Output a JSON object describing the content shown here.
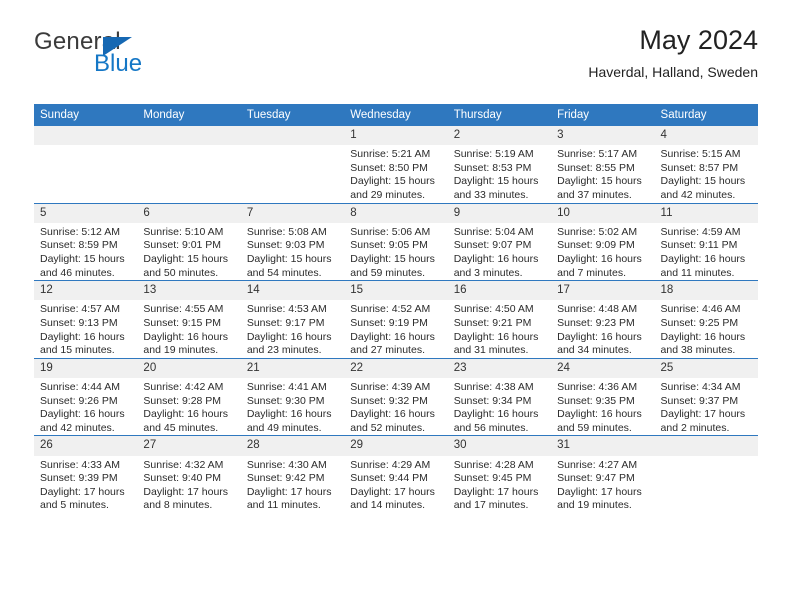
{
  "brand": {
    "name_top": "General",
    "name_bottom": "Blue",
    "triangle_color": "#1668b3",
    "blue_color": "#1577c6"
  },
  "header": {
    "title": "May 2024",
    "subtitle": "Haverdal, Halland, Sweden"
  },
  "theme": {
    "header_bg": "#2f78bf",
    "header_text": "#ffffff",
    "daynum_bg": "#f0f0f0",
    "grid_line": "#2f78bf",
    "page_bg": "#ffffff"
  },
  "calendar": {
    "weekday_headers": [
      "Sunday",
      "Monday",
      "Tuesday",
      "Wednesday",
      "Thursday",
      "Friday",
      "Saturday"
    ],
    "weeks": [
      [
        {
          "day": "",
          "empty": true
        },
        {
          "day": "",
          "empty": true
        },
        {
          "day": "",
          "empty": true
        },
        {
          "day": "1",
          "sunrise": "Sunrise: 5:21 AM",
          "sunset": "Sunset: 8:50 PM",
          "daylight": "Daylight: 15 hours and 29 minutes."
        },
        {
          "day": "2",
          "sunrise": "Sunrise: 5:19 AM",
          "sunset": "Sunset: 8:53 PM",
          "daylight": "Daylight: 15 hours and 33 minutes."
        },
        {
          "day": "3",
          "sunrise": "Sunrise: 5:17 AM",
          "sunset": "Sunset: 8:55 PM",
          "daylight": "Daylight: 15 hours and 37 minutes."
        },
        {
          "day": "4",
          "sunrise": "Sunrise: 5:15 AM",
          "sunset": "Sunset: 8:57 PM",
          "daylight": "Daylight: 15 hours and 42 minutes."
        }
      ],
      [
        {
          "day": "5",
          "sunrise": "Sunrise: 5:12 AM",
          "sunset": "Sunset: 8:59 PM",
          "daylight": "Daylight: 15 hours and 46 minutes."
        },
        {
          "day": "6",
          "sunrise": "Sunrise: 5:10 AM",
          "sunset": "Sunset: 9:01 PM",
          "daylight": "Daylight: 15 hours and 50 minutes."
        },
        {
          "day": "7",
          "sunrise": "Sunrise: 5:08 AM",
          "sunset": "Sunset: 9:03 PM",
          "daylight": "Daylight: 15 hours and 54 minutes."
        },
        {
          "day": "8",
          "sunrise": "Sunrise: 5:06 AM",
          "sunset": "Sunset: 9:05 PM",
          "daylight": "Daylight: 15 hours and 59 minutes."
        },
        {
          "day": "9",
          "sunrise": "Sunrise: 5:04 AM",
          "sunset": "Sunset: 9:07 PM",
          "daylight": "Daylight: 16 hours and 3 minutes."
        },
        {
          "day": "10",
          "sunrise": "Sunrise: 5:02 AM",
          "sunset": "Sunset: 9:09 PM",
          "daylight": "Daylight: 16 hours and 7 minutes."
        },
        {
          "day": "11",
          "sunrise": "Sunrise: 4:59 AM",
          "sunset": "Sunset: 9:11 PM",
          "daylight": "Daylight: 16 hours and 11 minutes."
        }
      ],
      [
        {
          "day": "12",
          "sunrise": "Sunrise: 4:57 AM",
          "sunset": "Sunset: 9:13 PM",
          "daylight": "Daylight: 16 hours and 15 minutes."
        },
        {
          "day": "13",
          "sunrise": "Sunrise: 4:55 AM",
          "sunset": "Sunset: 9:15 PM",
          "daylight": "Daylight: 16 hours and 19 minutes."
        },
        {
          "day": "14",
          "sunrise": "Sunrise: 4:53 AM",
          "sunset": "Sunset: 9:17 PM",
          "daylight": "Daylight: 16 hours and 23 minutes."
        },
        {
          "day": "15",
          "sunrise": "Sunrise: 4:52 AM",
          "sunset": "Sunset: 9:19 PM",
          "daylight": "Daylight: 16 hours and 27 minutes."
        },
        {
          "day": "16",
          "sunrise": "Sunrise: 4:50 AM",
          "sunset": "Sunset: 9:21 PM",
          "daylight": "Daylight: 16 hours and 31 minutes."
        },
        {
          "day": "17",
          "sunrise": "Sunrise: 4:48 AM",
          "sunset": "Sunset: 9:23 PM",
          "daylight": "Daylight: 16 hours and 34 minutes."
        },
        {
          "day": "18",
          "sunrise": "Sunrise: 4:46 AM",
          "sunset": "Sunset: 9:25 PM",
          "daylight": "Daylight: 16 hours and 38 minutes."
        }
      ],
      [
        {
          "day": "19",
          "sunrise": "Sunrise: 4:44 AM",
          "sunset": "Sunset: 9:26 PM",
          "daylight": "Daylight: 16 hours and 42 minutes."
        },
        {
          "day": "20",
          "sunrise": "Sunrise: 4:42 AM",
          "sunset": "Sunset: 9:28 PM",
          "daylight": "Daylight: 16 hours and 45 minutes."
        },
        {
          "day": "21",
          "sunrise": "Sunrise: 4:41 AM",
          "sunset": "Sunset: 9:30 PM",
          "daylight": "Daylight: 16 hours and 49 minutes."
        },
        {
          "day": "22",
          "sunrise": "Sunrise: 4:39 AM",
          "sunset": "Sunset: 9:32 PM",
          "daylight": "Daylight: 16 hours and 52 minutes."
        },
        {
          "day": "23",
          "sunrise": "Sunrise: 4:38 AM",
          "sunset": "Sunset: 9:34 PM",
          "daylight": "Daylight: 16 hours and 56 minutes."
        },
        {
          "day": "24",
          "sunrise": "Sunrise: 4:36 AM",
          "sunset": "Sunset: 9:35 PM",
          "daylight": "Daylight: 16 hours and 59 minutes."
        },
        {
          "day": "25",
          "sunrise": "Sunrise: 4:34 AM",
          "sunset": "Sunset: 9:37 PM",
          "daylight": "Daylight: 17 hours and 2 minutes."
        }
      ],
      [
        {
          "day": "26",
          "sunrise": "Sunrise: 4:33 AM",
          "sunset": "Sunset: 9:39 PM",
          "daylight": "Daylight: 17 hours and 5 minutes."
        },
        {
          "day": "27",
          "sunrise": "Sunrise: 4:32 AM",
          "sunset": "Sunset: 9:40 PM",
          "daylight": "Daylight: 17 hours and 8 minutes."
        },
        {
          "day": "28",
          "sunrise": "Sunrise: 4:30 AM",
          "sunset": "Sunset: 9:42 PM",
          "daylight": "Daylight: 17 hours and 11 minutes."
        },
        {
          "day": "29",
          "sunrise": "Sunrise: 4:29 AM",
          "sunset": "Sunset: 9:44 PM",
          "daylight": "Daylight: 17 hours and 14 minutes."
        },
        {
          "day": "30",
          "sunrise": "Sunrise: 4:28 AM",
          "sunset": "Sunset: 9:45 PM",
          "daylight": "Daylight: 17 hours and 17 minutes."
        },
        {
          "day": "31",
          "sunrise": "Sunrise: 4:27 AM",
          "sunset": "Sunset: 9:47 PM",
          "daylight": "Daylight: 17 hours and 19 minutes."
        },
        {
          "day": "",
          "empty": true
        }
      ]
    ]
  }
}
